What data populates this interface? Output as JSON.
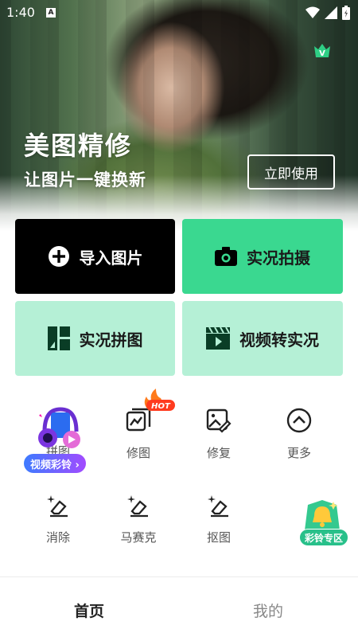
{
  "status_bar": {
    "time": "1:40",
    "notification_glyph": "A",
    "icons": [
      "wifi-icon",
      "signal-icon",
      "battery-icon"
    ]
  },
  "hero": {
    "title": "美图精修",
    "subtitle": "让图片一键换新",
    "cta_label": "立即使用",
    "vip_badge": "V"
  },
  "actions": {
    "import_label": "导入图片",
    "live_shoot_label": "实况拍摄",
    "live_collage_label": "实况拼图",
    "video_to_live_label": "视频转实况"
  },
  "tools": {
    "collage_label": "拼图",
    "retouch_label": "修图",
    "repair_label": "修复",
    "more_label": "更多",
    "erase_label": "消除",
    "mosaic_label": "马赛克",
    "cutout_label": "抠图",
    "hot_badge": "HOT"
  },
  "promos": {
    "video_ringtone_label": "视频彩铃 ›",
    "ringtone_zone_label": "彩铃专区"
  },
  "bottom_nav": {
    "home_label": "首页",
    "mine_label": "我的"
  },
  "colors": {
    "accent_green": "#3ad890",
    "light_green": "#b5f0d6",
    "black_card": "#000000"
  }
}
